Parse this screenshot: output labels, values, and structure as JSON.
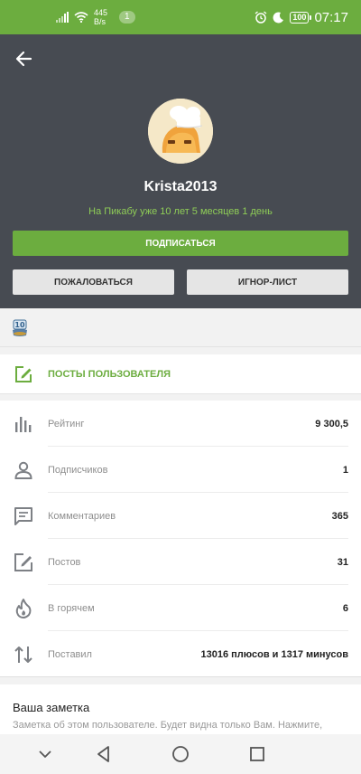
{
  "status_bar": {
    "net_speed_value": "445",
    "net_speed_unit": "B/s",
    "notification_count": "1",
    "battery": "100",
    "time": "07:17"
  },
  "profile": {
    "username": "Krista2013",
    "since": "На Пикабу уже 10 лет 5 месяцев 1 день",
    "subscribe_label": "ПОДПИСАТЬСЯ",
    "report_label": "ПОЖАЛОВАТЬСЯ",
    "ignore_label": "ИГНОР-ЛИСТ",
    "award_badge_text": "10"
  },
  "posts_link": {
    "label": "ПОСТЫ ПОЛЬЗОВАТЕЛЯ"
  },
  "stats": [
    {
      "icon": "rating-icon",
      "label": "Рейтинг",
      "value": "9 300,5"
    },
    {
      "icon": "user-icon",
      "label": "Подписчиков",
      "value": "1"
    },
    {
      "icon": "comment-icon",
      "label": "Комментариев",
      "value": "365"
    },
    {
      "icon": "edit-icon",
      "label": "Постов",
      "value": "31"
    },
    {
      "icon": "flame-icon",
      "label": "В горячем",
      "value": "6"
    },
    {
      "icon": "swap-icon",
      "label": "Поставил",
      "value": "13016 плюсов и 1317 минусов"
    }
  ],
  "note": {
    "title": "Ваша заметка",
    "hint": "Заметка об этом пользователе. Будет видна только Вам. Нажмите,"
  },
  "colors": {
    "accent": "#6cad3f",
    "header_bg": "#474b52",
    "since_text": "#8fcd57"
  }
}
